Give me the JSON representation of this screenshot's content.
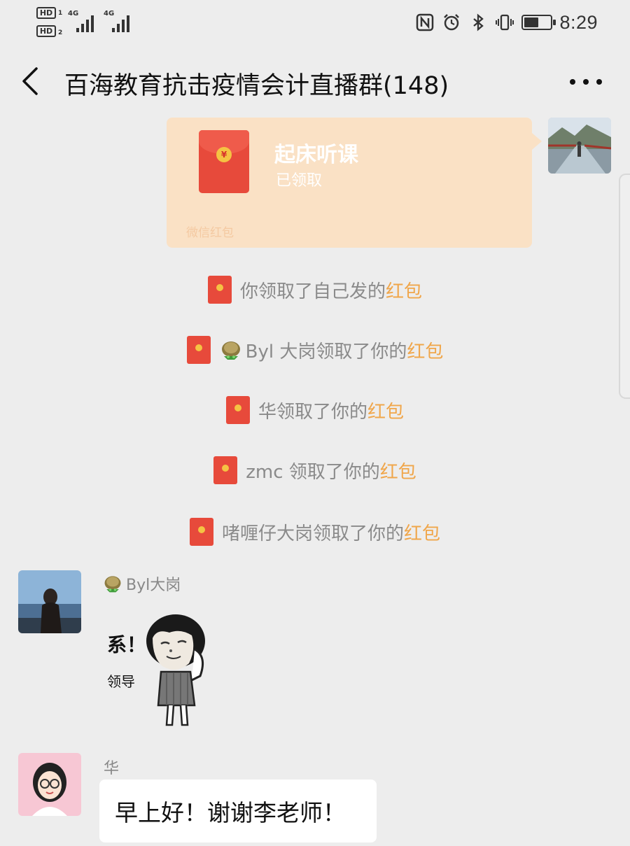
{
  "status_bar": {
    "sim1_badge": "HD",
    "sim1_index": "1",
    "sim2_badge": "HD",
    "sim2_index": "2",
    "sim1_network": "4G",
    "sim2_network": "4G",
    "time": "8:29",
    "battery_level": 0.55,
    "icons": [
      "nfc-icon",
      "alarm-icon",
      "bluetooth-icon",
      "vibrate-icon",
      "battery-icon"
    ]
  },
  "nav": {
    "title": "百海教育抗击疫情会计直播群(148)",
    "icons": [
      "back-arrow-icon",
      "more-dots-icon"
    ]
  },
  "red_packet": {
    "title": "起床听课",
    "status": "已领取",
    "footer": "微信红包"
  },
  "system_messages": [
    {
      "pre": "你领取了自己发的",
      "link": "红包",
      "has_emoji": false
    },
    {
      "pre": "Byl 大岗领取了你的",
      "link": "红包",
      "has_emoji": true
    },
    {
      "pre": "华领取了你的",
      "link": "红包",
      "has_emoji": false
    },
    {
      "pre": "zmc 领取了你的",
      "link": "红包",
      "has_emoji": false
    },
    {
      "pre": "啫喱仔大岗领取了你的",
      "link": "红包",
      "has_emoji": false
    }
  ],
  "messages": [
    {
      "sender": "Byl大岗",
      "type": "sticker",
      "sticker_text_big": "系！",
      "sticker_text_small": "领导"
    },
    {
      "sender": "华",
      "type": "text",
      "text": "早上好！谢谢李老师！"
    }
  ],
  "colors": {
    "background": "#ededed",
    "red_packet_bg": "#fae1c5",
    "envelope_red": "#e74a3b",
    "link_orange": "#f0a64a",
    "system_text": "#8a8a8a"
  }
}
